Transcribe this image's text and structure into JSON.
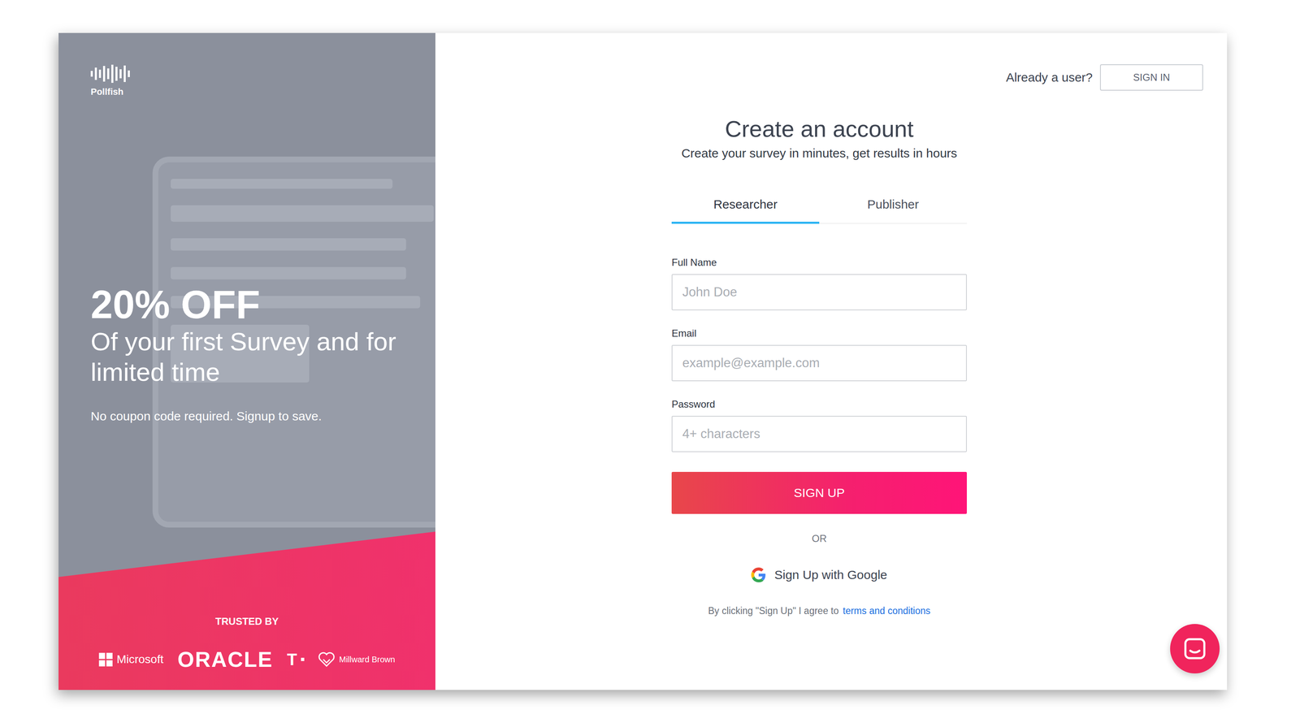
{
  "brand": {
    "name": "Pollfish"
  },
  "promo": {
    "headline": "20% OFF",
    "subheadline": "Of your first Survey and for limited time",
    "note": "No coupon code required. Signup to save."
  },
  "trusted": {
    "label": "TRUSTED BY",
    "logos": [
      {
        "name": "Microsoft",
        "kind": "microsoft"
      },
      {
        "name": "ORACLE",
        "kind": "oracle"
      },
      {
        "name": "T",
        "kind": "telekom"
      },
      {
        "name": "Millward Brown",
        "kind": "millward"
      }
    ]
  },
  "header": {
    "prompt": "Already a user?",
    "button": "SIGN IN"
  },
  "form": {
    "title": "Create an account",
    "subtitle": "Create your survey in minutes, get results in hours",
    "tabs": [
      {
        "label": "Researcher",
        "selected": true
      },
      {
        "label": "Publisher",
        "selected": false
      }
    ],
    "fields": [
      {
        "label": "Full Name",
        "placeholder": "John Doe"
      },
      {
        "label": "Email",
        "placeholder": "example@example.com"
      },
      {
        "label": "Password",
        "placeholder": "4+ characters"
      }
    ],
    "submit": "SIGN UP",
    "divider": "OR",
    "google": "Sign Up with Google",
    "terms_prefix": "By clicking \"Sign Up\" I agree to",
    "terms_link": "terms and conditions"
  }
}
